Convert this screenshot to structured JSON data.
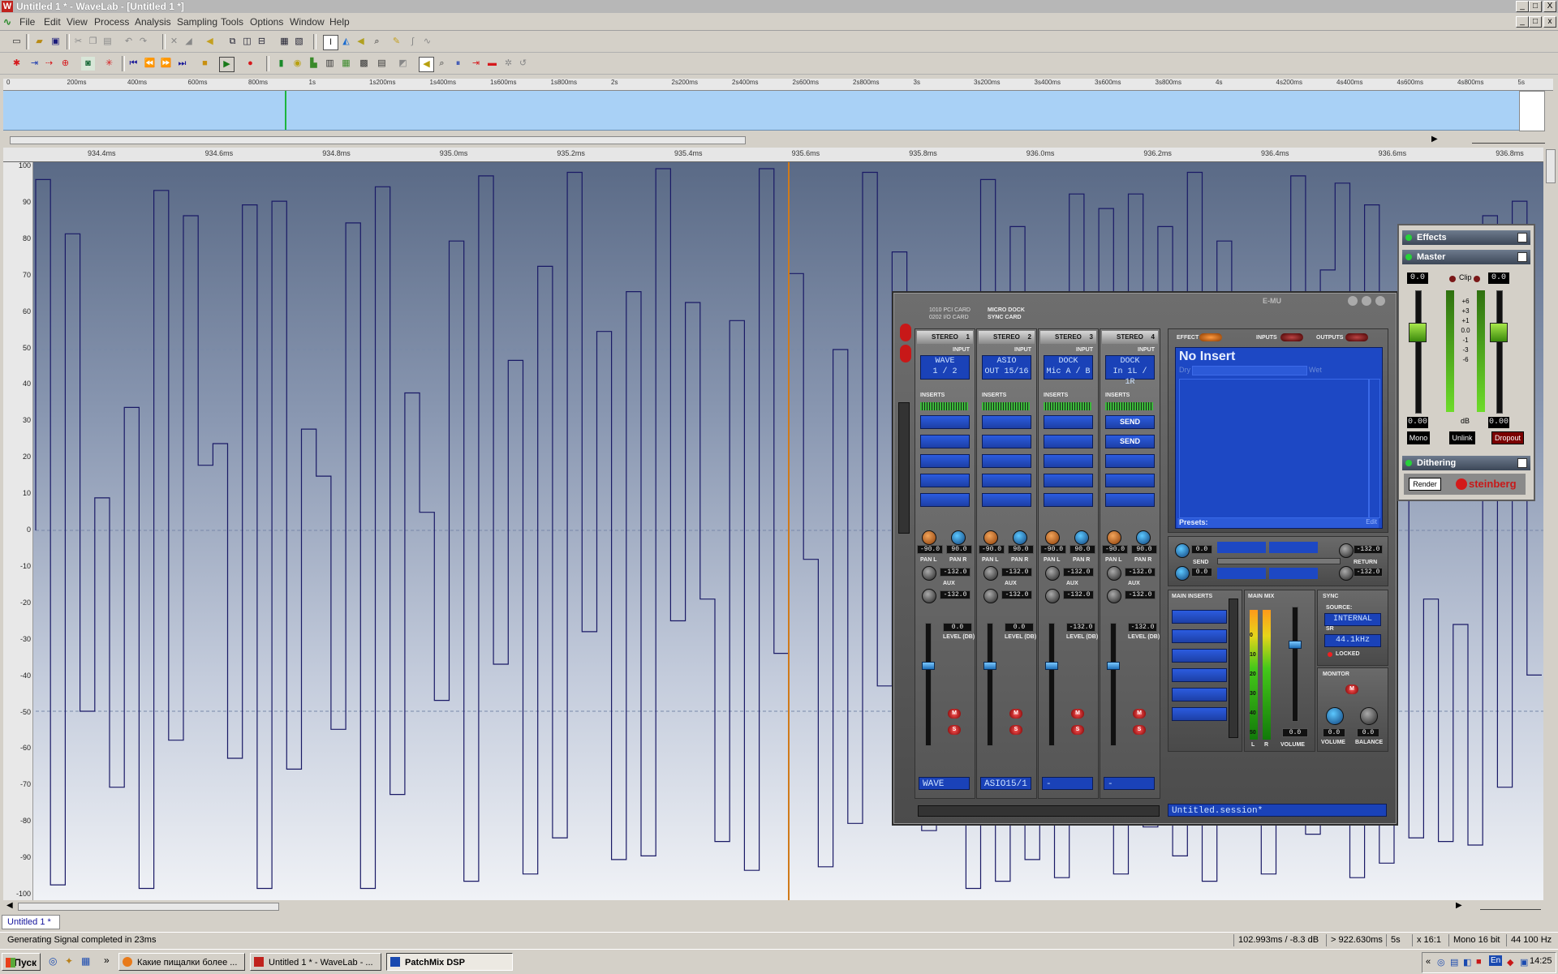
{
  "window": {
    "title": "Untitled 1 * - WaveLab - [Untitled 1 *]",
    "controls": [
      "_",
      "□",
      "X"
    ]
  },
  "menu": [
    "File",
    "Edit",
    "View",
    "Process",
    "Analysis",
    "Sampling",
    "Tools",
    "Options",
    "Window",
    "Help"
  ],
  "overview_ruler": [
    "0",
    "200ms",
    "400ms",
    "600ms",
    "800ms",
    "1s",
    "1s200ms",
    "1s400ms",
    "1s600ms",
    "1s800ms",
    "2s",
    "2s200ms",
    "2s400ms",
    "2s600ms",
    "2s800ms",
    "3s",
    "3s200ms",
    "3s400ms",
    "3s600ms",
    "3s800ms",
    "4s",
    "4s200ms",
    "4s400ms",
    "4s600ms",
    "4s800ms",
    "5s"
  ],
  "main_ruler": [
    "934.4ms",
    "934.6ms",
    "934.8ms",
    "935.0ms",
    "935.2ms",
    "935.4ms",
    "935.6ms",
    "935.8ms",
    "936.0ms",
    "936.2ms",
    "936.4ms",
    "936.6ms",
    "936.8ms"
  ],
  "y_axis": [
    "100",
    "90",
    "80",
    "70",
    "60",
    "50",
    "40",
    "30",
    "20",
    "10",
    "0",
    "-10",
    "-20",
    "-30",
    "-40",
    "-50",
    "-60",
    "-70",
    "-80",
    "-90",
    "-100"
  ],
  "waveform_levels": [
    97,
    -98,
    82,
    -50,
    9,
    -71,
    34,
    -99,
    94,
    -58,
    87,
    18,
    24,
    -63,
    90,
    -99,
    91,
    -66,
    28,
    15,
    -55,
    85,
    -99,
    95,
    -73,
    38,
    5,
    -47,
    80,
    -97,
    98,
    -37,
    47,
    -95,
    73,
    -85,
    99,
    -28,
    55,
    -91,
    66,
    -90,
    100,
    -25,
    63,
    -19,
    -86,
    58,
    -94,
    100,
    -34,
    71,
    -8,
    -93,
    50,
    -81,
    99,
    -43,
    77,
    1,
    -83,
    -75,
    41,
    -99,
    97,
    -97,
    84,
    -91,
    58,
    -96,
    93,
    -38,
    89,
    -95,
    93,
    -82,
    84,
    -90,
    99,
    -97,
    80,
    -74,
    59,
    -95,
    -80,
    98,
    -84,
    72,
    96,
    -96,
    90,
    -92,
    58,
    -85,
    -19,
    -86,
    -26,
    -87,
    87,
    -71,
    91,
    -40
  ],
  "doc_tab": "Untitled 1 *",
  "status": {
    "message": "Generating Signal completed in 23ms",
    "position": "102.993ms / -8.3 dB",
    "selection": "> 922.630ms",
    "length": "5s",
    "zoom": "x 16:1",
    "format": "Mono 16 bit",
    "rate": "44 100 Hz"
  },
  "taskbar": {
    "start": "Пуск",
    "tasks": [
      "Какие пищалки более ...",
      "Untitled 1 * - WaveLab - ...",
      "PatchMix DSP"
    ],
    "clock": "14:25",
    "lang": "En"
  },
  "patchmix": {
    "cards": [
      "1010 PCI CARD",
      "0202 I/O CARD"
    ],
    "options": [
      "MICRO DOCK",
      "SYNC CARD"
    ],
    "brand": "E-MU",
    "strips": [
      {
        "name": "STEREO",
        "num": "1",
        "input_label": "INPUT",
        "input": [
          "WAVE",
          "1 / 2"
        ],
        "inserts": [
          "",
          "",
          "",
          "",
          ""
        ],
        "pan_l": "-90.0",
        "pan_r": "90.0",
        "aux1": "-132.0",
        "aux2": "-132.0",
        "level": "0.0",
        "bottom": "WAVE"
      },
      {
        "name": "STEREO",
        "num": "2",
        "input_label": "INPUT",
        "input": [
          "ASIO",
          "OUT 15/16"
        ],
        "inserts": [
          "",
          "",
          "",
          "",
          ""
        ],
        "pan_l": "-90.0",
        "pan_r": "90.0",
        "aux1": "-132.0",
        "aux2": "-132.0",
        "level": "0.0",
        "bottom": "ASIO15/1"
      },
      {
        "name": "STEREO",
        "num": "3",
        "input_label": "INPUT",
        "input": [
          "DOCK",
          "Mic A / B"
        ],
        "inserts": [
          "",
          "",
          "",
          "",
          ""
        ],
        "pan_l": "-90.0",
        "pan_r": "90.0",
        "aux1": "-132.0",
        "aux2": "-132.0",
        "level": "-132.0",
        "bottom": "-"
      },
      {
        "name": "STEREO",
        "num": "4",
        "input_label": "INPUT",
        "input": [
          "DOCK",
          "In 1L / 1R"
        ],
        "inserts": [
          "SEND",
          "SEND",
          "",
          "",
          ""
        ],
        "pan_l": "-90.0",
        "pan_r": "90.0",
        "aux1": "-132.0",
        "aux2": "-132.0",
        "level": "-132.0",
        "bottom": "-"
      }
    ],
    "labels": {
      "inserts": "INSERTS",
      "pan_l": "PAN L",
      "pan_r": "PAN R",
      "aux": "AUX",
      "level": "LEVEL (DB)",
      "mute": "M",
      "solo": "S"
    },
    "effect": {
      "tabs": [
        "EFFECT",
        "INPUTS",
        "OUTPUTS"
      ],
      "title": "No Insert",
      "dry": "Dry",
      "wet": "Wet",
      "presets": "Presets:",
      "presets_edit": "Edit"
    },
    "send": {
      "send_label": "SEND",
      "return_label": "RETURN",
      "send_top": "0.0",
      "send_bottom": "0.0",
      "return_top": "-132.0",
      "return_bottom": "-132.0"
    },
    "main": {
      "inserts_label": "MAIN INSERTS",
      "mix_label": "MAIN MIX",
      "meter_scale": [
        "0",
        "10",
        "20",
        "30",
        "40",
        "50"
      ],
      "volume": "0.0",
      "volume_label": "VOLUME",
      "l": "L",
      "r": "R"
    },
    "sync": {
      "label": "SYNC",
      "source_label": "SOURCE:",
      "source": "INTERNAL",
      "sr_label": "SR",
      "sr": "44.1kHz",
      "locked": "LOCKED"
    },
    "monitor": {
      "label": "MONITOR",
      "mute": "M",
      "volume": "0.0",
      "balance": "0.0",
      "volume_label": "VOLUME",
      "balance_label": "BALANCE"
    },
    "session": "Untitled.session*"
  },
  "master_section": {
    "effects": "Effects",
    "master": "Master",
    "clip": "Clip",
    "left_peak": "0.0",
    "right_peak": "0.0",
    "scale": [
      "+6",
      "+3",
      "+1",
      "0.0",
      "-1",
      "-3",
      "-6"
    ],
    "db": "dB",
    "left_gain": "0.00",
    "right_gain": "0.00",
    "mono": "Mono",
    "unlink": "Unlink",
    "dropout": "Dropout",
    "dithering": "Dithering",
    "render": "Render",
    "brand": "steinberg"
  }
}
